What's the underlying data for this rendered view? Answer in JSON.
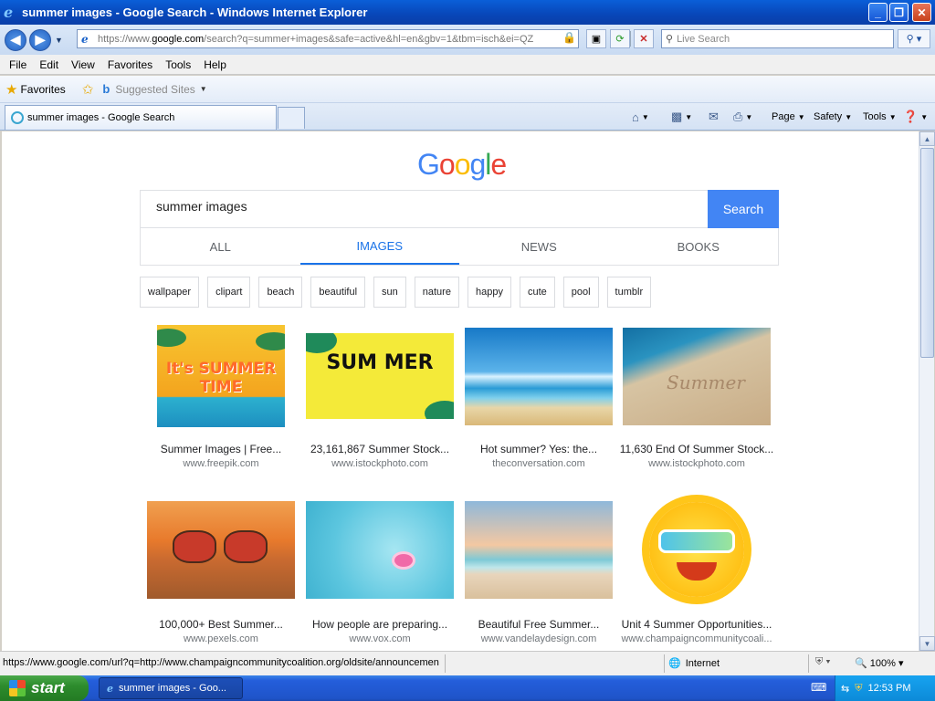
{
  "window": {
    "title": "summer images - Google Search - Windows Internet Explorer",
    "controls": {
      "minimize": "_",
      "maximize": "❐",
      "close": "✕"
    }
  },
  "address": {
    "url_prefix": "https://www.",
    "url_domain": "google.com",
    "url_rest": "/search?q=summer+images&safe=active&hl=en&gbv=1&tbm=isch&ei=QZ",
    "live_search_placeholder": "Live Search"
  },
  "menu": [
    "File",
    "Edit",
    "View",
    "Favorites",
    "Tools",
    "Help"
  ],
  "favorites_bar": {
    "favorites_label": "Favorites",
    "suggested_sites": "Suggested Sites"
  },
  "tabs": {
    "active_tab": "summer images - Google Search"
  },
  "commandbar": {
    "page": "Page",
    "safety": "Safety",
    "tools": "Tools"
  },
  "google": {
    "logo_letters": [
      "G",
      "o",
      "o",
      "g",
      "l",
      "e"
    ],
    "query": "summer images",
    "search_button": "Search",
    "tabs": [
      "ALL",
      "IMAGES",
      "NEWS",
      "BOOKS"
    ],
    "active_tab": "IMAGES",
    "chips": [
      "wallpaper",
      "clipart",
      "beach",
      "beautiful",
      "sun",
      "nature",
      "happy",
      "cute",
      "pool",
      "tumblr"
    ],
    "results": [
      {
        "title": "Summer Images | Free...",
        "source": "www.freepik.com",
        "image_text": "It's SUMMER TIME"
      },
      {
        "title": "23,161,867 Summer Stock...",
        "source": "www.istockphoto.com",
        "image_text": "SUM MER"
      },
      {
        "title": "Hot summer? Yes: the...",
        "source": "theconversation.com"
      },
      {
        "title": "11,630 End Of Summer Stock...",
        "source": "www.istockphoto.com",
        "image_text": "Summer"
      },
      {
        "title": "100,000+ Best Summer...",
        "source": "www.pexels.com"
      },
      {
        "title": "How people are preparing...",
        "source": "www.vox.com"
      },
      {
        "title": "Beautiful Free Summer...",
        "source": "www.vandelaydesign.com"
      },
      {
        "title": "Unit 4 Summer Opportunities...",
        "source": "www.champaigncommunitycoali..."
      }
    ]
  },
  "status": {
    "url": "https://www.google.com/url?q=http://www.champaigncommunitycoalition.org/oldsite/announcemen",
    "zone": "Internet",
    "zoom": "100%"
  },
  "taskbar": {
    "start": "start",
    "task_item": "summer images - Goo...",
    "clock": "12:53 PM"
  }
}
